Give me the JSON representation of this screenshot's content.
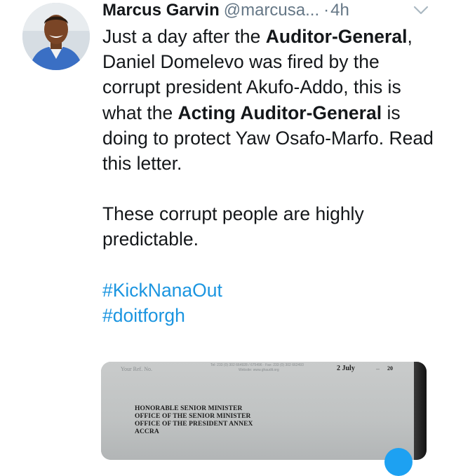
{
  "tweet": {
    "author_name": "Marcus Garvin",
    "author_handle": "@marcusa...",
    "separator": "·",
    "time": "4h",
    "body": {
      "p1": [
        {
          "text": "Just a day after the ",
          "bold": false
        },
        {
          "text": "Auditor-General",
          "bold": true
        },
        {
          "text": ", Daniel Domelevo was fired by the corrupt president Akufo-Addo, this is what the ",
          "bold": false
        },
        {
          "text": "Acting Auditor-General",
          "bold": true
        },
        {
          "text": " is doing to protect Yaw Osafo-Marfo. Read this letter.",
          "bold": false
        }
      ],
      "p2": "These corrupt people are highly predictable.",
      "hashtags": [
        "#KickNanaOut",
        "#doitforgh"
      ]
    },
    "media": {
      "ref_label": "Your Ref. No.",
      "tel_line": "Tel: 233 (0) 302 664928 / 675496 · Fax: 233 (0) 302 662493",
      "website_line": "Website: www.ghaudit.org",
      "date_day": "2 July",
      "date_year": "20",
      "address_lines": [
        "HONORABLE SENIOR MINISTER",
        "OFFICE OF THE SENIOR MINISTER",
        "OFFICE OF THE PRESIDENT ANNEX",
        "ACCRA"
      ]
    }
  },
  "colors": {
    "link": "#1b95e0",
    "secondary_text": "#657786",
    "primary_text": "#14171a"
  },
  "icons": [
    "avatar",
    "chevron-down-icon"
  ]
}
